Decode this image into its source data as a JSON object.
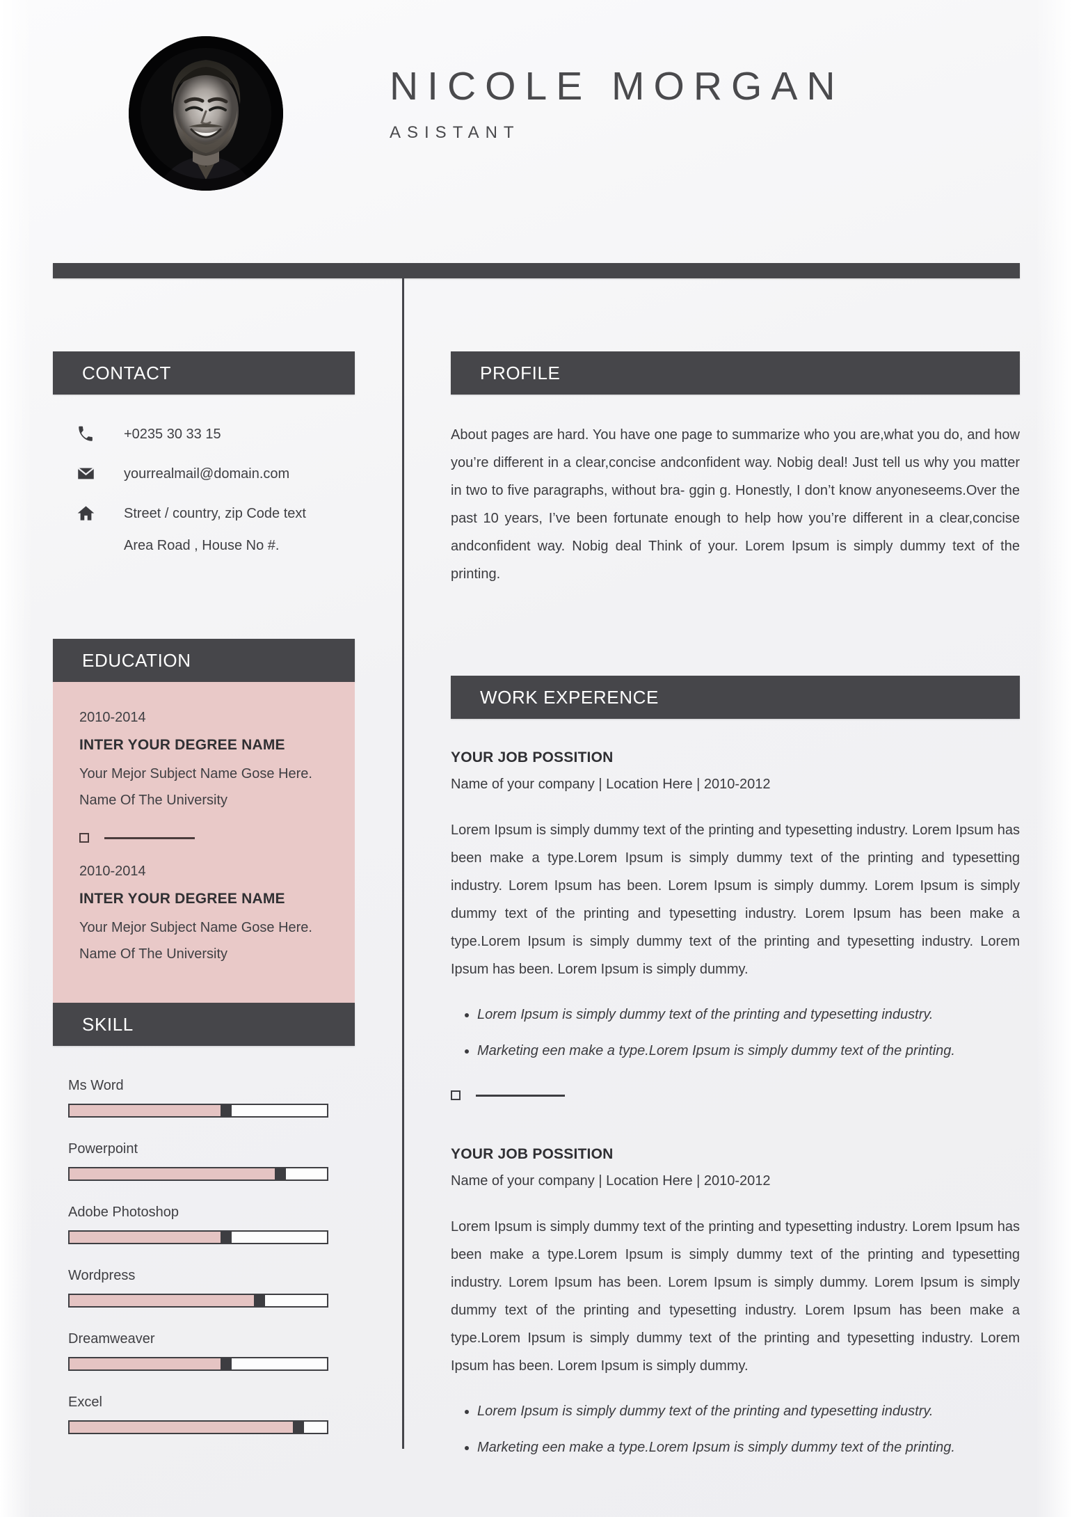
{
  "colors": {
    "bar_dark": "#46464a",
    "accent_pink": "#e9c9c8",
    "skill_fill": "#e5c4c3",
    "text_dark": "#3b3b3f",
    "page_bg": "#f2f2f4"
  },
  "header": {
    "full_name": "NICOLE MORGAN",
    "job_title": "ASISTANT",
    "photo_alt": "portrait-photo"
  },
  "sidebar": {
    "contact": {
      "heading": "CONTACT",
      "items": [
        {
          "icon": "phone-icon",
          "value": "+0235 30 33 15"
        },
        {
          "icon": "envelope-icon",
          "value": "yourrealmail@domain.com"
        },
        {
          "icon": "home-icon",
          "value": "Street / country, zip Code text"
        }
      ],
      "extra_line": "Area Road , House No #."
    },
    "education": {
      "heading": "EDUCATION",
      "items": [
        {
          "years": "2010-2014",
          "degree": "INTER YOUR DEGREE NAME",
          "subject": "Your Mejor Subject Name Gose Here.",
          "university": "Name Of The University"
        },
        {
          "years": "2010-2014",
          "degree": "INTER YOUR DEGREE NAME",
          "subject": "Your Mejor Subject Name Gose Here.",
          "university": "Name Of The University"
        }
      ]
    },
    "skill": {
      "heading": "SKILL",
      "items": [
        {
          "name": "Ms Word",
          "level": 63
        },
        {
          "name": "Powerpoint",
          "level": 84
        },
        {
          "name": "Adobe Photoshop",
          "level": 63
        },
        {
          "name": "Wordpress",
          "level": 76
        },
        {
          "name": "Dreamweaver",
          "level": 63
        },
        {
          "name": "Excel",
          "level": 91
        }
      ]
    }
  },
  "main": {
    "profile": {
      "heading": "PROFILE",
      "text": "About pages are hard. You have one page to summarize who you are,what you do, and how you’re different in a clear,concise andconfident way. Nobig deal! Just tell us why you matter in two to five paragraphs, without bra- ggin g. Honestly, I don’t know anyoneseems.Over the past 10 years, I’ve been fortunate enough to help how you’re different in a clear,concise andconfident way. Nobig deal Think of your. Lorem Ipsum is simply dummy text of the printing."
    },
    "work": {
      "heading": "WORK EXPERENCE",
      "jobs": [
        {
          "title": "YOUR JOB POSSITION",
          "meta": "Name of your company | Location Here | 2010-2012",
          "body": "Lorem Ipsum is simply dummy text of the printing and typesetting industry. Lorem Ipsum has been make a type.Lorem Ipsum is simply dummy text of the printing and typesetting industry. Lorem Ipsum has been. Lorem Ipsum is simply dummy. Lorem Ipsum is simply dummy text of the printing and typesetting industry. Lorem Ipsum has been make a type.Lorem Ipsum is simply dummy text of the printing and typesetting industry. Lorem Ipsum has been. Lorem Ipsum is simply dummy.",
          "bullets": [
            "Lorem Ipsum is simply dummy text of the printing and typesetting industry.",
            "Marketing een make a type.Lorem Ipsum is simply dummy text of the printing."
          ]
        },
        {
          "title": "YOUR JOB POSSITION",
          "meta": "Name of your company | Location Here | 2010-2012",
          "body": "Lorem Ipsum is simply dummy text of the printing and typesetting industry. Lorem Ipsum has been make a type.Lorem Ipsum is simply dummy text of the printing and typesetting industry. Lorem Ipsum has been. Lorem Ipsum is simply dummy. Lorem Ipsum is simply dummy text of the printing and typesetting industry. Lorem Ipsum has been make a type.Lorem Ipsum is simply dummy text of the printing and typesetting industry. Lorem Ipsum has been. Lorem Ipsum is simply dummy.",
          "bullets": [
            "Lorem Ipsum is simply dummy text of the printing and typesetting industry.",
            "Marketing een make a type.Lorem Ipsum is simply dummy text of the printing."
          ]
        }
      ]
    }
  }
}
